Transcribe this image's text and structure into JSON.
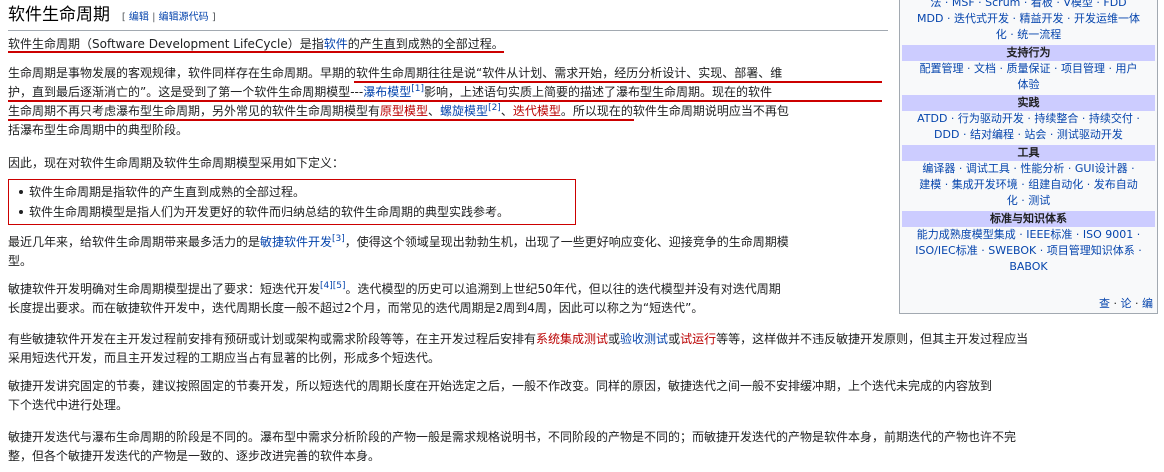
{
  "heading": {
    "title": "软件生命周期",
    "edit_bracket_open": "[",
    "edit": "编辑",
    "sep": "|",
    "edit_source": "编辑源代码",
    "edit_bracket_close": "]"
  },
  "para1": {
    "a": "软件生命周期（Software Development LifeCycle）是指",
    "link": "软件",
    "b": "的产生直到成熟的全部过程。"
  },
  "para2": {
    "l1a": "生命周期是事物发展的客观规律，软件同样存在生命周期。早期的软件生命周期往往是说“软件从计划、需求开始，经历分析设计、实现、部署、维",
    "l2a": "护，直到最后逐渐消亡的”。这是受到了第一个软件生命周期模型---",
    "l2link": "瀑布模型",
    "l2sup": "[1]",
    "l2b": "影响，上述语句实质上简要的描述了瀑布型生命周期。现在的软件",
    "l3a": "生命周期不再只考虑瀑布型生命周期，另外常见的软件生命周期模型有",
    "l3r1": "原型模型",
    "l3s1": "、",
    "l3l1": "螺旋模型",
    "l3sup": "[2]",
    "l3s2": "、",
    "l3r2": "迭代模型",
    "l3b": "。所以现在的软件生命周期说明应当不再包",
    "l4": "括瀑布型生命周期中的典型阶段。"
  },
  "para3": "因此，现在对软件生命周期及软件生命周期模型采用如下定义：",
  "definitions": [
    "软件生命周期是指软件的产生直到成熟的全部过程。",
    "软件生命周期模型是指人们为开发更好的软件而归纳总结的软件生命周期的典型实践参考。"
  ],
  "para4": {
    "a": "最近几年来，给软件生命周期带来最多活力的是",
    "link": "敏捷软件开发",
    "sup": "[3]",
    "b": "，使得这个领域呈现出勃勃生机，出现了一些更好响应变化、迎接竞争的生命周期模",
    "l2": "型。"
  },
  "para5": {
    "a": "敏捷软件开发明确对生命周期模型提出了要求：短迭代开发",
    "sup": "[4][5]",
    "b": "。迭代模型的历史可以追溯到上世纪50年代，但以往的迭代模型并没有对迭代周期",
    "l2": "长度提出要求。而在敏捷软件开发中，迭代周期长度一般不超过2个月，而常见的迭代周期是2周到4周，因此可以称之为“短迭代”。"
  },
  "para6": {
    "a": "有些敏捷软件开发在主开发过程前安排有预研或计划或架构或需求阶段等等，在主开发过程后安排有",
    "r1": "系统集成测试",
    "o1": "或",
    "l1": "验收测试",
    "o2": "或",
    "r2": "试运行",
    "b": "等等，这样做并不违反敏捷开发原则，但其主开发过程应当",
    "l2": "采用短迭代开发，而且主开发过程的工期应当占有显著的比例，形成多个短迭代。"
  },
  "para7": {
    "l1": "敏捷开发讲究固定的节奏，建议按照固定的节奏开发，所以短迭代的周期长度在开始选定之后，一般不作改变。同样的原因，敏捷迭代之间一般不安排缓冲期，上个迭代未完成的内容放到",
    "l2": "下个迭代中进行处理。"
  },
  "para8": {
    "l1": "敏捷开发迭代与瀑布生命周期的阶段是不同的。瀑布型中需求分析阶段的产物一般是需求规格说明书，不同阶段的产物是不同的；而敏捷开发迭代的产物是软件本身，前期迭代的产物也许不完",
    "l2": "整，但各个敏捷开发迭代的产物是一致的、逐步改进完善的软件本身。"
  },
  "sidebar": {
    "top_l1": "法 · MSF · Scrum · 看板 · V模型 · FDD",
    "top_l2": "MDD · 迭代式开发 · 精益开发 · 开发运维一体",
    "top_l3": "化 · 统一流程",
    "sections": [
      {
        "title": "支持行为",
        "lines": [
          "配置管理 · 文档 · 质量保证 · 项目管理 · 用户",
          "体验"
        ]
      },
      {
        "title": "实践",
        "lines": [
          "ATDD · 行为驱动开发 · 持续整合 · 持续交付 ·",
          "DDD · 结对编程 · 站会 · 测试驱动开发"
        ]
      },
      {
        "title": "工具",
        "lines": [
          "编译器 · 调试工具 · 性能分析 · GUI设计器 ·",
          "建模 · 集成开发环境 · 组建自动化 · 发布自动",
          "化 · 测试"
        ]
      },
      {
        "title": "标准与知识体系",
        "lines": [
          "能力成熟度模型集成 · IEEE标准 · ISO 9001 ·",
          "ISO/IEC标准 · SWEBOK · 项目管理知识体系 ·",
          "BABOK"
        ]
      }
    ],
    "vte": {
      "view": "查",
      "talk": "论",
      "edit": "编",
      "dot": "·"
    }
  }
}
